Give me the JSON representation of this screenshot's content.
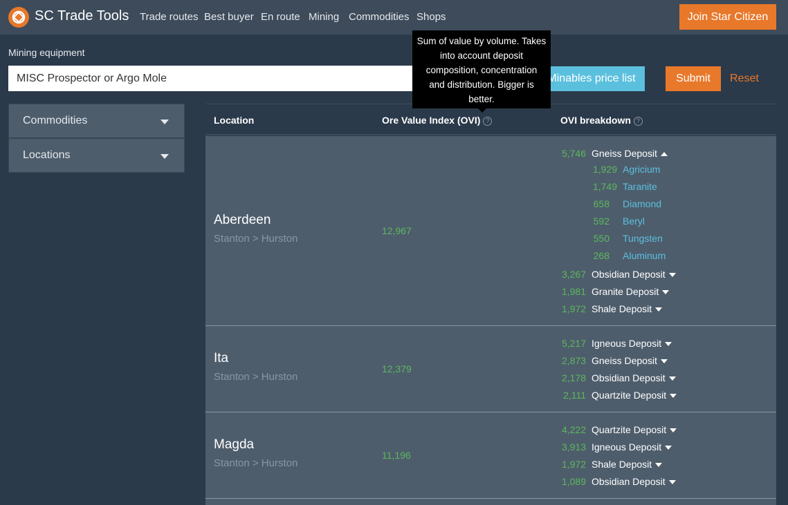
{
  "nav": {
    "brand": "SC Trade Tools",
    "links": [
      "Trade routes",
      "Best buyer",
      "En route",
      "Mining",
      "Commodities",
      "Shops"
    ],
    "join_label": "Join Star Citizen"
  },
  "form": {
    "equipment_label": "Mining equipment",
    "equipment_value": "MISC Prospector or Argo Mole",
    "minables_label": "Minables price list",
    "submit_label": "Submit",
    "reset_label": "Reset"
  },
  "tooltip": {
    "lines": [
      "Sum of value by volume. Takes",
      "into account deposit",
      "composition, concentration",
      "and distribution. Bigger is",
      "better."
    ]
  },
  "sidebar": {
    "panels": [
      "Commodities",
      "Locations"
    ]
  },
  "table": {
    "headers": [
      "Location",
      "Ore Value Index (OVI)",
      "OVI breakdown"
    ],
    "rows": [
      {
        "name": "Aberdeen",
        "path": "Stanton > Hurston",
        "ovi": "12,967",
        "deposits": [
          {
            "value": "5,746",
            "name": "Gneiss Deposit",
            "expanded": true,
            "commodities": [
              {
                "value": "1,929",
                "name": "Agricium"
              },
              {
                "value": "1,749",
                "name": "Taranite"
              },
              {
                "value": "658",
                "name": "Diamond"
              },
              {
                "value": "592",
                "name": "Beryl"
              },
              {
                "value": "550",
                "name": "Tungsten"
              },
              {
                "value": "268",
                "name": "Aluminum"
              }
            ]
          },
          {
            "value": "3,267",
            "name": "Obsidian Deposit"
          },
          {
            "value": "1,981",
            "name": "Granite Deposit"
          },
          {
            "value": "1,972",
            "name": "Shale Deposit"
          }
        ]
      },
      {
        "name": "Ita",
        "path": "Stanton > Hurston",
        "ovi": "12,379",
        "deposits": [
          {
            "value": "5,217",
            "name": "Igneous Deposit"
          },
          {
            "value": "2,873",
            "name": "Gneiss Deposit"
          },
          {
            "value": "2,178",
            "name": "Obsidian Deposit"
          },
          {
            "value": "2,111",
            "name": "Quartzite Deposit"
          }
        ]
      },
      {
        "name": "Magda",
        "path": "Stanton > Hurston",
        "ovi": "11,196",
        "deposits": [
          {
            "value": "4,222",
            "name": "Quartzite Deposit"
          },
          {
            "value": "3,913",
            "name": "Igneous Deposit"
          },
          {
            "value": "1,972",
            "name": "Shale Deposit"
          },
          {
            "value": "1,089",
            "name": "Obsidian Deposit"
          }
        ]
      }
    ]
  },
  "colors": {
    "accent": "#e8782a",
    "info": "#5bc0de",
    "success": "#5cb85c",
    "background": "#2b3a4a",
    "panel": "#4e5d6c"
  }
}
